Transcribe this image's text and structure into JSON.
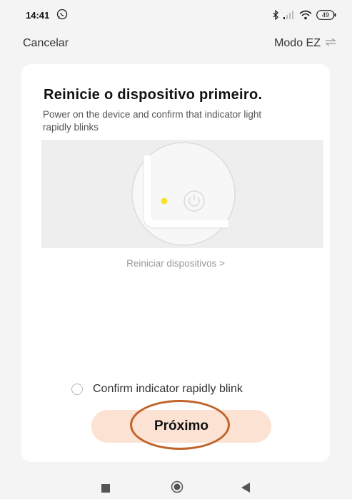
{
  "status_bar": {
    "time": "14:41",
    "battery": "49"
  },
  "topbar": {
    "cancel_label": "Cancelar",
    "mode_label": "Modo EZ",
    "mode_icon": "swap-arrows-icon"
  },
  "card": {
    "title": "Reinicie o dispositivo primeiro.",
    "subtitle": "Power on the device and confirm that indicator light rapidly blinks",
    "link_label": "Reiniciar dispositivos >",
    "confirm_label": "Confirm indicator rapidly blink",
    "confirm_checked": false,
    "next_label": "Próximo"
  },
  "colors": {
    "accent_button": "#fbe2d3",
    "highlight_ring": "#c0642a",
    "indicator_light": "#f5e52a"
  }
}
